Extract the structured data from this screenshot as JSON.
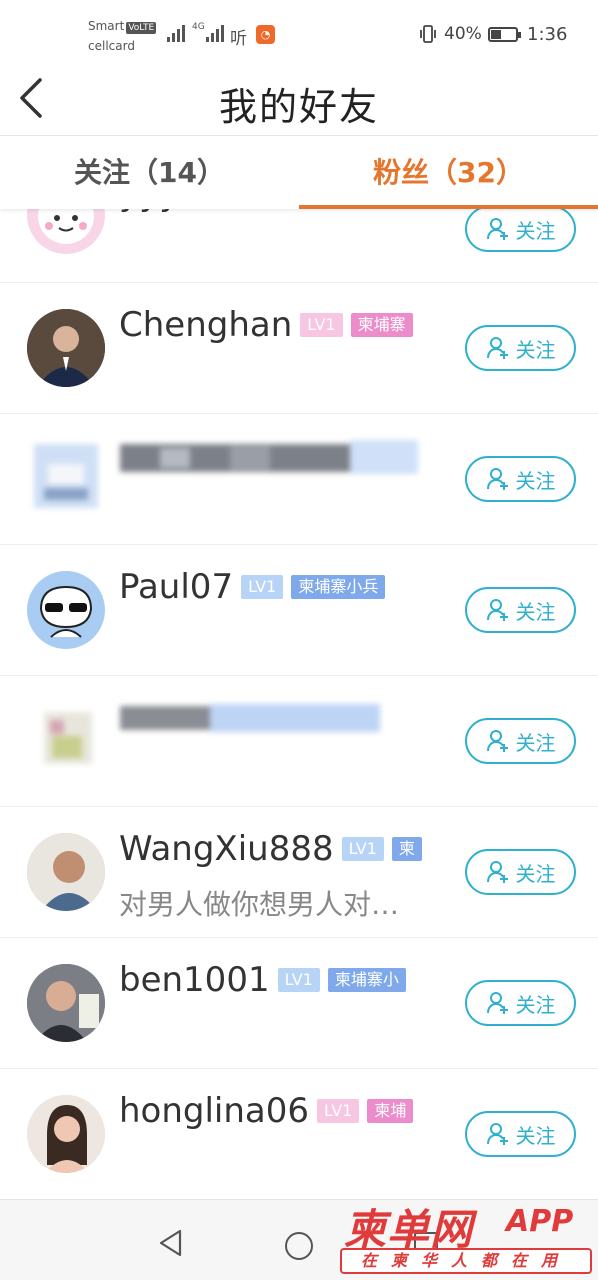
{
  "status_bar": {
    "carrier_line1": "Smart",
    "volte": "VoLTE",
    "carrier_line2": "cellcard",
    "network": "4G",
    "listen_app": "听",
    "battery_percent": "40%",
    "battery_level": 0.4,
    "time": "1:36"
  },
  "header": {
    "title": "我的好友"
  },
  "tabs": [
    {
      "label": "关注（14）",
      "active": false
    },
    {
      "label": "粉丝（32）",
      "active": true
    }
  ],
  "colors": {
    "accent": "#e5762e",
    "follow": "#2fb0ce"
  },
  "follow_label": "关注",
  "friends": [
    {
      "name": "yyy",
      "level": "",
      "title": "",
      "bio": ""
    },
    {
      "name": "Chenghan",
      "level": "LV1",
      "title": "柬埔寨",
      "bio": ""
    },
    {
      "name": "",
      "level": "",
      "title": "",
      "bio": ""
    },
    {
      "name": "Paul07",
      "level": "LV1",
      "title": "柬埔寨小兵",
      "bio": ""
    },
    {
      "name": "",
      "level": "",
      "title": "",
      "bio": ""
    },
    {
      "name": "WangXiu888",
      "level": "LV1",
      "title": "柬",
      "bio": "对男人做你想男人对…"
    },
    {
      "name": "ben1001",
      "level": "LV1",
      "title": "柬埔寨小",
      "bio": ""
    },
    {
      "name": "honglina06",
      "level": "LV1",
      "title": "柬埔",
      "bio": ""
    }
  ],
  "watermark": {
    "brand": "柬单网",
    "app": "APP",
    "slogan": "在柬华人都在用"
  }
}
